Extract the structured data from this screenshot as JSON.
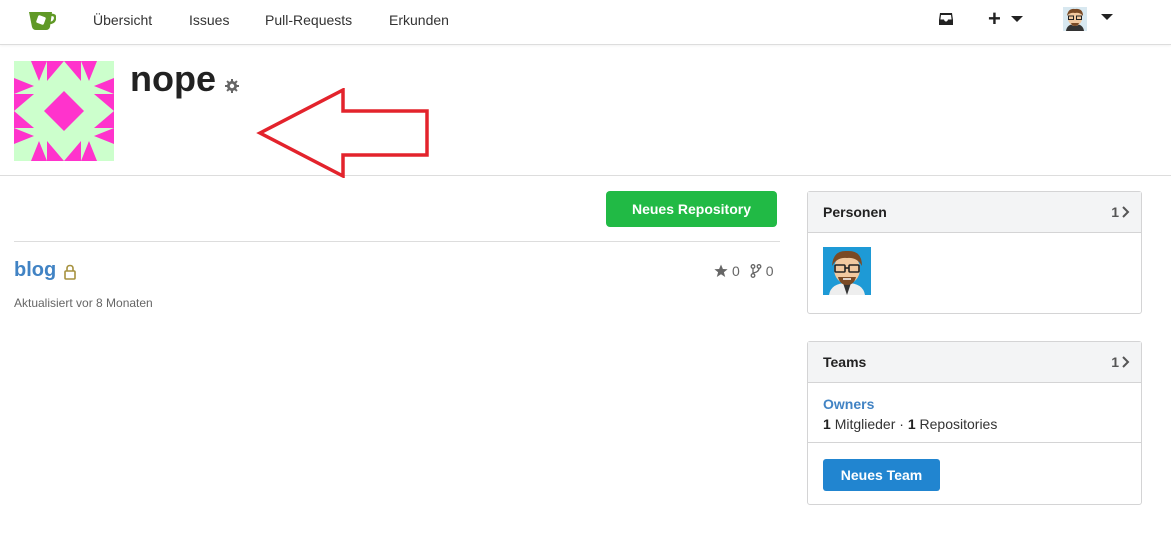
{
  "nav": {
    "items": [
      "Übersicht",
      "Issues",
      "Pull-Requests",
      "Erkunden"
    ],
    "plus_label": "+"
  },
  "org": {
    "name": "nope"
  },
  "main": {
    "new_repo_button": "Neues Repository",
    "repos": [
      {
        "name": "blog",
        "stars": "0",
        "forks": "0",
        "updated": "Aktualisiert vor 8 Monaten"
      }
    ]
  },
  "people": {
    "title": "Personen",
    "count": "1"
  },
  "teams": {
    "title": "Teams",
    "count": "1",
    "team_name": "Owners",
    "members_count": "1",
    "members_label": "Mitglieder",
    "separator": "·",
    "repos_count": "1",
    "repos_label": "Repositories",
    "new_team_button": "Neues Team"
  },
  "colors": {
    "green": "#21ba45",
    "blue": "#2185d0",
    "link": "#4183c4",
    "arrow": "#e3232c",
    "identicon_bg": "#ccffcc",
    "identicon_fg": "#ff33cc"
  },
  "icons": [
    "gitea-logo-icon",
    "inbox-icon",
    "plus-icon",
    "caret-down-icon",
    "gear-icon",
    "lock-icon",
    "star-icon",
    "fork-icon",
    "chevron-right-icon"
  ]
}
